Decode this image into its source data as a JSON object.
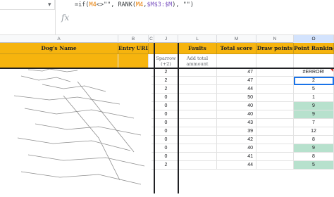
{
  "formula": {
    "prefix": "=if(",
    "ref1": "M4",
    "middle": "<>\"\", RANK(",
    "ref2": "M4",
    "middle2": ",",
    "ref3": "$M$3:$M",
    "suffix": "), \"\")"
  },
  "fx_label": "fx",
  "columns": [
    "A",
    "B",
    "C",
    "J",
    "L",
    "M",
    "N",
    "O"
  ],
  "headers": {
    "dog_name": "Dog's Name",
    "entry_url": "Entry URL",
    "faults": "Faults",
    "total_score": "Total score",
    "draw_points": "Draw points",
    "point_ranking": "Point Ranking"
  },
  "subheaders": {
    "sparrow": "Sparrow (+2)",
    "add_total": "Add total ammount"
  },
  "rows": [
    {
      "j": "2",
      "m": "47",
      "o": "#ERROR!",
      "green": false
    },
    {
      "j": "2",
      "m": "47",
      "o": "2",
      "green": false
    },
    {
      "j": "2",
      "m": "44",
      "o": "5",
      "green": false
    },
    {
      "j": "0",
      "m": "50",
      "o": "1",
      "green": false
    },
    {
      "j": "0",
      "m": "40",
      "o": "9",
      "green": true
    },
    {
      "j": "0",
      "m": "40",
      "o": "9",
      "green": true
    },
    {
      "j": "0",
      "m": "43",
      "o": "7",
      "green": false
    },
    {
      "j": "0",
      "m": "39",
      "o": "12",
      "green": false
    },
    {
      "j": "0",
      "m": "42",
      "o": "8",
      "green": false
    },
    {
      "j": "0",
      "m": "40",
      "o": "9",
      "green": true
    },
    {
      "j": "0",
      "m": "41",
      "o": "8",
      "green": false
    },
    {
      "j": "2",
      "m": "44",
      "o": "5",
      "green": true
    }
  ],
  "colors": {
    "header_bg": "#f6b40e",
    "rank_highlight": "#b7e1cd",
    "selection": "#1a73e8",
    "error_flag": "#d93025"
  }
}
